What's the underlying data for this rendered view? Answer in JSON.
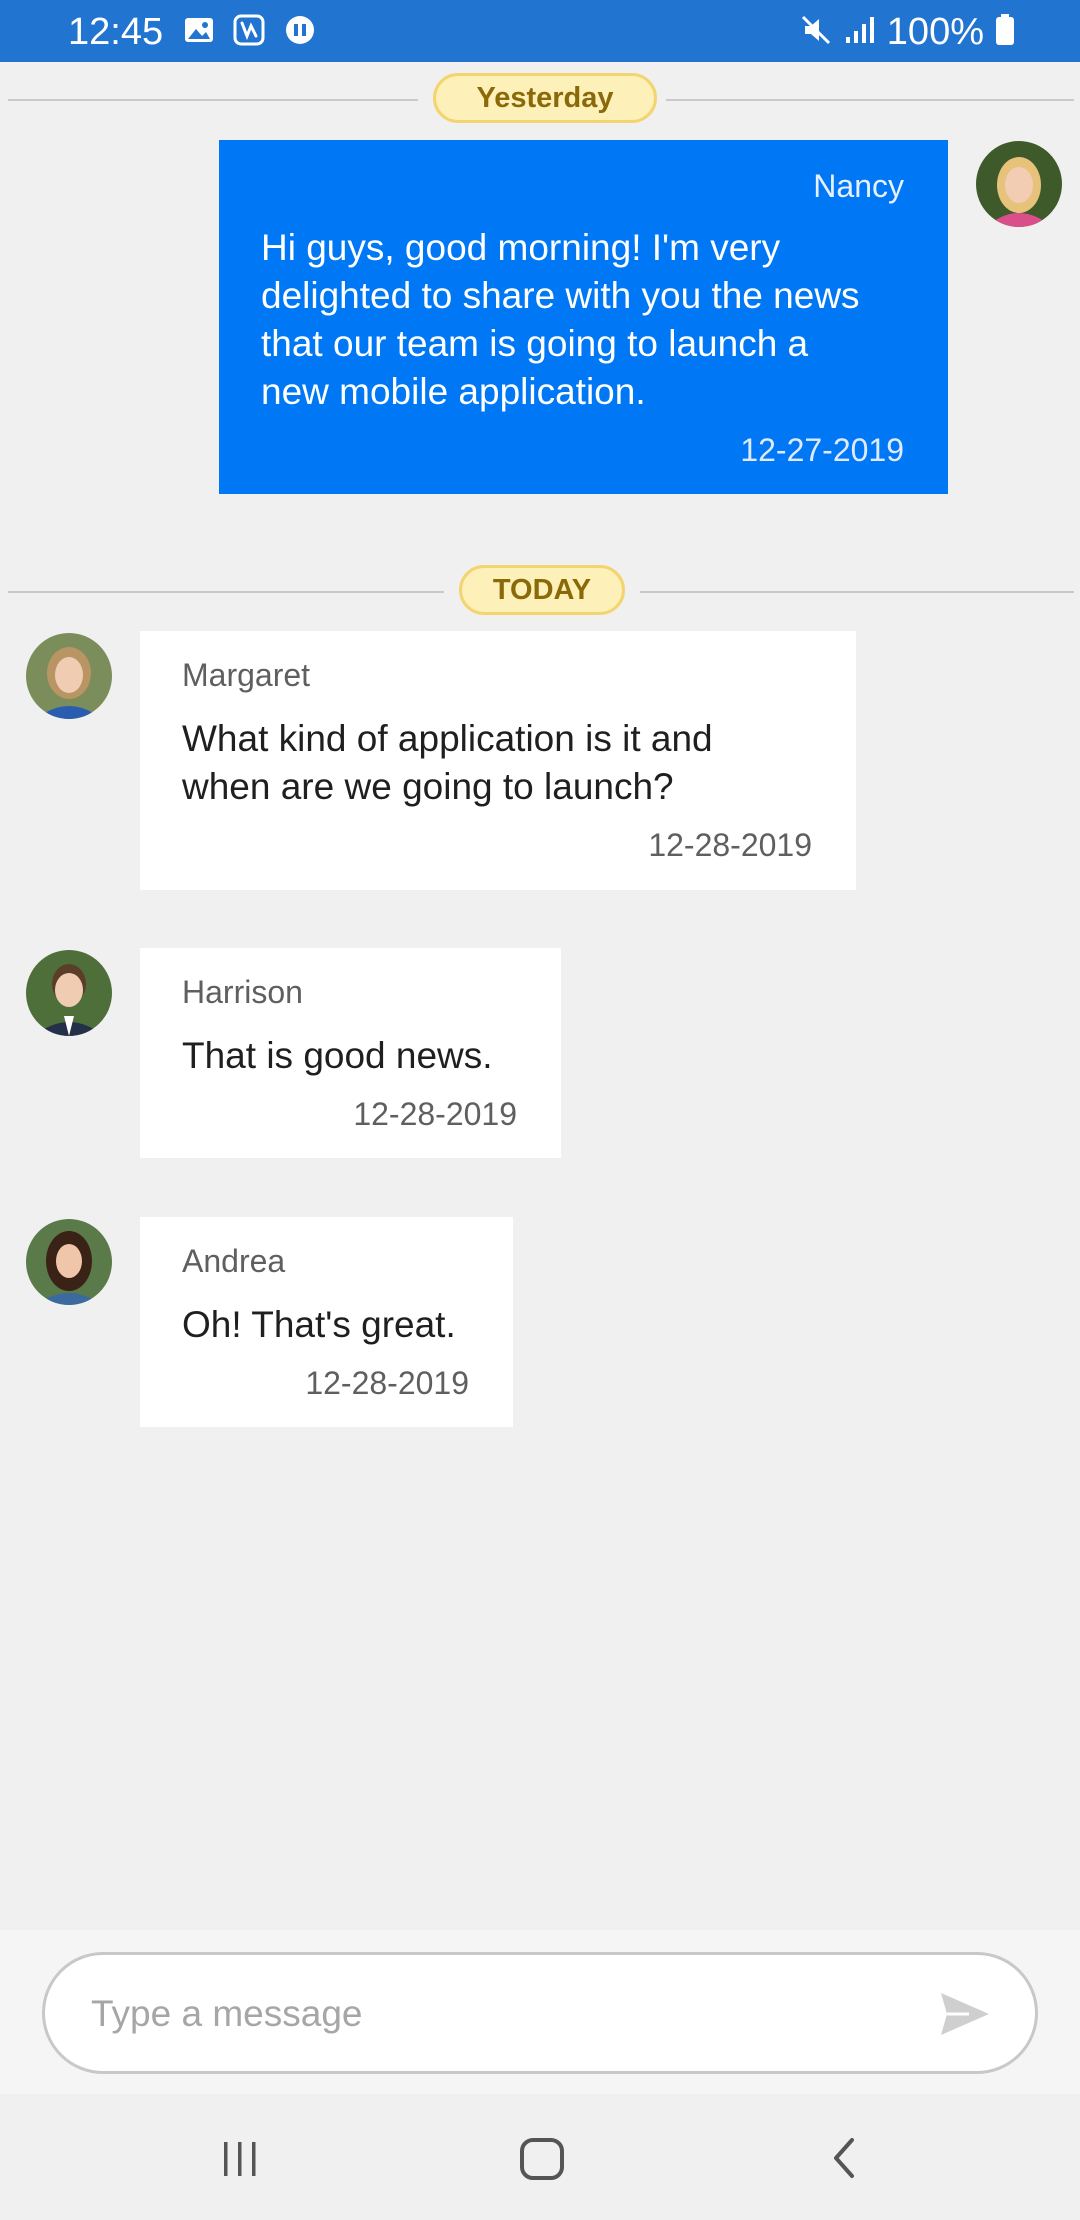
{
  "status_bar": {
    "time": "12:45",
    "battery": "100%",
    "icons": [
      "gallery-icon",
      "app-icon",
      "media-icon",
      "mute-icon",
      "signal-icon",
      "battery-icon"
    ],
    "background": "#2274d1"
  },
  "separators": {
    "yesterday": "Yesterday",
    "today": "TODAY"
  },
  "messages": [
    {
      "sender": "Nancy",
      "text": "Hi guys, good morning! I'm very delighted to share with you the news that our team is going to launch a new mobile application.",
      "date": "12-27-2019",
      "own": true
    },
    {
      "sender": "Margaret",
      "text": "What kind of application is it and when are we going to launch?",
      "date": "12-28-2019",
      "own": false
    },
    {
      "sender": "Harrison",
      "text": "That is good news.",
      "date": "12-28-2019",
      "own": false
    },
    {
      "sender": "Andrea",
      "text": "Oh! That's great.",
      "date": "12-28-2019",
      "own": false
    }
  ],
  "composer": {
    "placeholder": "Type a message",
    "value": ""
  },
  "colors": {
    "own_bubble": "#0078f5",
    "other_bubble": "#ffffff",
    "badge_bg": "#fdf0b8",
    "badge_text": "#8a6a08"
  },
  "nav": {
    "icons": [
      "recents-icon",
      "home-icon",
      "back-icon"
    ]
  }
}
